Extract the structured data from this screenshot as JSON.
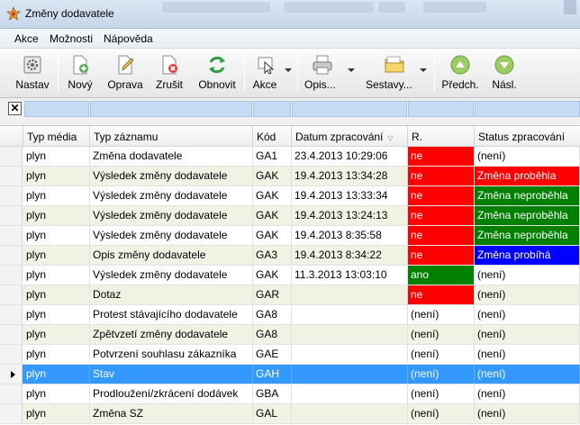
{
  "window": {
    "title": "Změny dodavatele"
  },
  "menu": [
    "Akce",
    "Možnosti",
    "Nápověda"
  ],
  "toolbar": {
    "nastav": "Nastav",
    "novy": "Nový",
    "oprava": "Oprava",
    "zrusit": "Zrušit",
    "obnovit": "Obnovit",
    "akce": "Akce",
    "opis": "Opis...",
    "sestavy": "Sestavy...",
    "predch": "Předch.",
    "nasl": "Násl."
  },
  "filter": {
    "clear_glyph": "✕"
  },
  "columns": [
    "Typ média",
    "Typ záznamu",
    "Kód",
    "Datum zpracování",
    "R.",
    "Status zpracování"
  ],
  "colors": {
    "red": "#ff0000",
    "green": "#008000",
    "blue": "#0000ff",
    "selection": "#3399ff"
  },
  "rows": [
    {
      "media": "plyn",
      "typ": "Změna dodavatele",
      "kod": "GA1",
      "datum": "23.4.2013 10:29:06",
      "r": "ne",
      "r_color": "red",
      "status": "(není)",
      "status_color": ""
    },
    {
      "media": "plyn",
      "typ": "Výsledek změny dodavatele",
      "kod": "GAK",
      "datum": "19.4.2013 13:34:28",
      "r": "ne",
      "r_color": "red",
      "status": "Změna proběhla",
      "status_color": "red"
    },
    {
      "media": "plyn",
      "typ": "Výsledek změny dodavatele",
      "kod": "GAK",
      "datum": "19.4.2013 13:33:34",
      "r": "ne",
      "r_color": "red",
      "status": "Změna neproběhla",
      "status_color": "green"
    },
    {
      "media": "plyn",
      "typ": "Výsledek změny dodavatele",
      "kod": "GAK",
      "datum": "19.4.2013 13:24:13",
      "r": "ne",
      "r_color": "red",
      "status": "Změna neproběhla",
      "status_color": "green"
    },
    {
      "media": "plyn",
      "typ": "Výsledek změny dodavatele",
      "kod": "GAK",
      "datum": "19.4.2013 8:35:58",
      "r": "ne",
      "r_color": "red",
      "status": "Změna neproběhla",
      "status_color": "green"
    },
    {
      "media": "plyn",
      "typ": "Opis změny dodavatele",
      "kod": "GA3",
      "datum": "19.4.2013 8:34:22",
      "r": "ne",
      "r_color": "red",
      "status": "Změna probíhá",
      "status_color": "blue"
    },
    {
      "media": "plyn",
      "typ": "Výsledek změny dodavatele",
      "kod": "GAK",
      "datum": "11.3.2013 13:03:10",
      "r": "ano",
      "r_color": "green",
      "status": "(není)",
      "status_color": ""
    },
    {
      "media": "plyn",
      "typ": "Dotaz",
      "kod": "GAR",
      "datum": "",
      "r": "ne",
      "r_color": "red",
      "status": "(není)",
      "status_color": ""
    },
    {
      "media": "plyn",
      "typ": "Protest stávajícího dodavatele",
      "kod": "GA8",
      "datum": "",
      "r": "(není)",
      "r_color": "",
      "status": "(není)",
      "status_color": ""
    },
    {
      "media": "plyn",
      "typ": "Zpětvzetí změny dodavatele",
      "kod": "GA8",
      "datum": "",
      "r": "(není)",
      "r_color": "",
      "status": "(není)",
      "status_color": ""
    },
    {
      "media": "plyn",
      "typ": "Potvrzení souhlasu zákazníka",
      "kod": "GAE",
      "datum": "",
      "r": "(není)",
      "r_color": "",
      "status": "(není)",
      "status_color": ""
    },
    {
      "media": "plyn",
      "typ": "Stav",
      "kod": "GAH",
      "datum": "",
      "r": "(není)",
      "r_color": "",
      "status": "(není)",
      "status_color": "",
      "selected": true
    },
    {
      "media": "plyn",
      "typ": "Prodloužení/zkrácení dodávek",
      "kod": "GBA",
      "datum": "",
      "r": "(není)",
      "r_color": "",
      "status": "(není)",
      "status_color": ""
    },
    {
      "media": "plyn",
      "typ": "Změna SZ",
      "kod": "GAL",
      "datum": "",
      "r": "(není)",
      "r_color": "",
      "status": "(není)",
      "status_color": ""
    }
  ]
}
